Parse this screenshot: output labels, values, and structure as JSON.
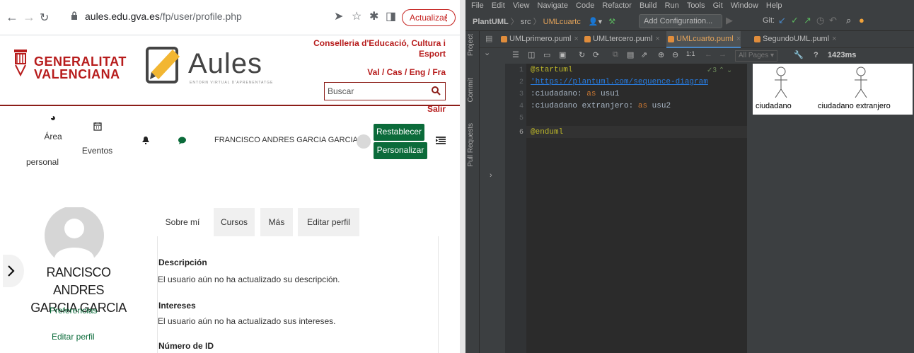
{
  "browser": {
    "url_domain": "aules.edu.gva.es",
    "url_path": "/fp/user/profile.php",
    "update_label": "Actualizar",
    "header": {
      "gva_line1": "GENERALITAT",
      "gva_line2": "VALENCIANA",
      "aules_word": "Aules",
      "aules_subtitle": "ENTORN VIRTUAL D'APRENENTATGE",
      "conselleria": "Conselleria d'Educació, Cultura i Esport",
      "languages": "Val / Cas / Eng / Fra",
      "search_placeholder": "Buscar",
      "logout": "Salir"
    },
    "nav": {
      "area_line1": "Área",
      "area_line2": "personal",
      "eventos": "Eventos",
      "user_name": "FRANCISCO ANDRES GARCIA GARCIA",
      "reset_button": "Restablecer",
      "customize_button": "Personalizar"
    },
    "profile": {
      "name_line1": "RANCISCO ANDRES",
      "name_line2": "GARCIA GARCIA",
      "link_preferences": "Preferencias",
      "link_edit_profile": "Editar perfil",
      "tabs": [
        "Sobre mí",
        "Cursos",
        "Más",
        "Editar perfil"
      ],
      "description_title": "Descripción",
      "description_text": "El usuario aún no ha actualizado su descripción.",
      "interests_title": "Intereses",
      "interests_text": "El usuario aún no ha actualizado sus intereses.",
      "id_title": "Número de ID"
    }
  },
  "ide": {
    "menu": [
      "File",
      "Edit",
      "View",
      "Navigate",
      "Code",
      "Refactor",
      "Build",
      "Run",
      "Tools",
      "Git",
      "Window",
      "Help"
    ],
    "breadcrumb_project": "PlantUML",
    "breadcrumb_src": "src",
    "breadcrumb_file": "UMLcuartc",
    "add_configuration": "Add Configuration...",
    "git_label": "Git:",
    "side_labels": [
      "Project",
      "Commit",
      "Pull Requests"
    ],
    "file_tabs": [
      "UMLprimero.puml",
      "UMLtercero.puml",
      "UMLcuarto.puml",
      "SegundoUML.puml"
    ],
    "all_pages": "All Pages",
    "render_time": "1423ms",
    "inspection": "3",
    "line_numbers": [
      "1",
      "2",
      "3",
      "4",
      "5",
      "6"
    ],
    "code": {
      "line1": "@startuml",
      "line2": "'https://plantuml.com/sequence-diagram",
      "line3_a": ":ciudadano:",
      "line3_kw": "as",
      "line3_b": "usu1",
      "line4_a": ":ciudadano extranjero:",
      "line4_kw": "as",
      "line4_b": "usu2",
      "line6": "@enduml"
    },
    "preview_actors": [
      "ciudadano",
      "ciudadano extranjero"
    ]
  }
}
